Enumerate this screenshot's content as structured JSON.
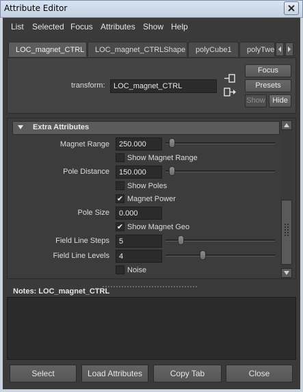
{
  "window": {
    "title": "Attribute Editor"
  },
  "menu": [
    "List",
    "Selected",
    "Focus",
    "Attributes",
    "Show",
    "Help"
  ],
  "tabs": [
    {
      "label": "LOC_magnet_CTRL",
      "active": true
    },
    {
      "label": "LOC_magnet_CTRLShape",
      "active": false
    },
    {
      "label": "polyCube1",
      "active": false
    },
    {
      "label": "polyTwe",
      "active": false
    }
  ],
  "transform": {
    "label": "transform:",
    "value": "LOC_magnet_CTRL"
  },
  "side_buttons": {
    "focus": "Focus",
    "presets": "Presets",
    "show": "Show",
    "hide": "Hide"
  },
  "section": {
    "title": "Extra Attributes",
    "expanded": true
  },
  "attributes": {
    "magnet_range": {
      "label": "Magnet Range",
      "value": "250.000",
      "slider_fraction": 0.03
    },
    "show_magnet_range": {
      "label": "Show Magnet Range",
      "checked": false
    },
    "pole_distance": {
      "label": "Pole Distance",
      "value": "150.000",
      "slider_fraction": 0.03
    },
    "show_poles": {
      "label": "Show Poles",
      "checked": false
    },
    "magnet_power": {
      "label": "Magnet Power",
      "checked": true
    },
    "pole_size": {
      "label": "Pole Size",
      "value": "0.000"
    },
    "show_magnet_geo": {
      "label": "Show Magnet Geo",
      "checked": true
    },
    "field_line_steps": {
      "label": "Field Line Steps",
      "value": "5",
      "slider_fraction": 0.12
    },
    "field_line_levels": {
      "label": "Field Line Levels",
      "value": "4",
      "slider_fraction": 0.33
    },
    "noise": {
      "label": "Noise",
      "checked": false
    }
  },
  "notes": {
    "label": "Notes:  LOC_magnet_CTRL",
    "text": ""
  },
  "bottom_buttons": {
    "select": "Select",
    "load": "Load Attributes",
    "copy": "Copy Tab",
    "close": "Close"
  },
  "icons": {
    "close": "close-icon",
    "tab_left": "chevron-left-icon",
    "tab_right": "chevron-right-icon",
    "input_connection": "input-connection-icon",
    "output_connection": "output-connection-icon",
    "collapse": "triangle-down-icon",
    "scroll_up": "scroll-up-icon",
    "scroll_down": "scroll-down-icon",
    "check": "check-icon"
  }
}
